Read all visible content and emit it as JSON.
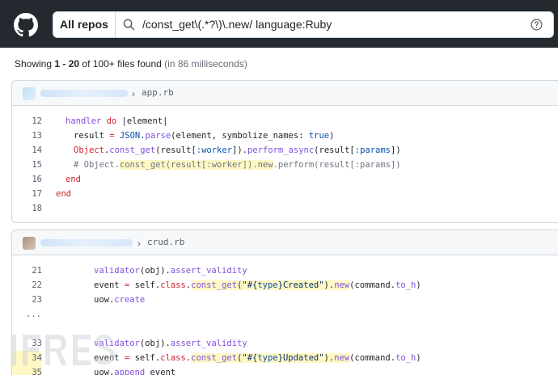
{
  "header": {
    "repo_scope": "All repos",
    "query": "/const_get\\(.*?\\)\\.new/ language:Ruby",
    "search_icon": "search-icon",
    "help_icon": "question-circle-icon",
    "logo": "github-logo"
  },
  "summary": {
    "showing": "Showing",
    "range": "1 - 20",
    "of_text": "of 100+ files found",
    "time": "(in 86 milliseconds)"
  },
  "results": [
    {
      "file": "app.rb",
      "lines": [
        {
          "n": "12"
        },
        {
          "n": "13"
        },
        {
          "n": "14"
        },
        {
          "n": "15"
        },
        {
          "n": "16"
        },
        {
          "n": "17"
        },
        {
          "n": "18"
        }
      ]
    },
    {
      "file": "crud.rb",
      "lines": [
        {
          "n": "21"
        },
        {
          "n": "22"
        },
        {
          "n": "23"
        },
        {
          "n": "..."
        },
        {
          "n": ""
        },
        {
          "n": "33"
        },
        {
          "n": "34"
        },
        {
          "n": "35"
        }
      ]
    }
  ],
  "colors": {
    "topbar": "#24292f",
    "highlight": "#fff8c5",
    "keyword": "#cf222e",
    "function": "#8250df"
  }
}
